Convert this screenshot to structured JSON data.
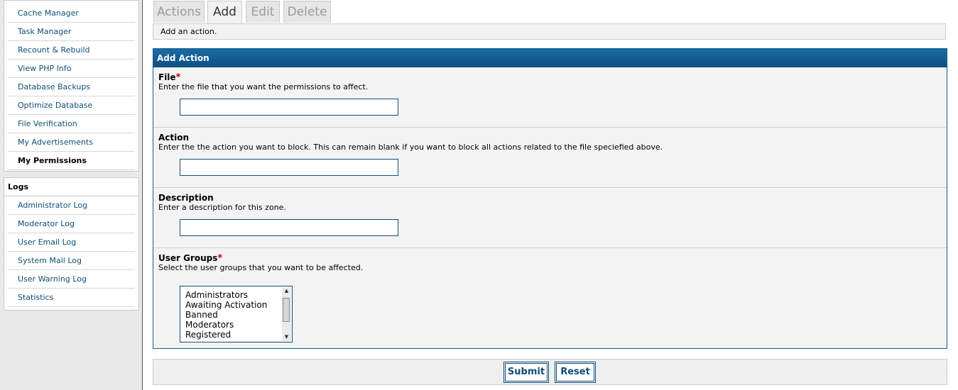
{
  "sidebar": {
    "top_items": [
      {
        "label": "Cache Manager"
      },
      {
        "label": "Task Manager"
      },
      {
        "label": "Recount & Rebuild"
      },
      {
        "label": "View PHP Info"
      },
      {
        "label": "Database Backups"
      },
      {
        "label": "Optimize Database"
      },
      {
        "label": "File Verification"
      },
      {
        "label": "My Advertisements"
      },
      {
        "label": "My Permissions"
      }
    ],
    "logs_title": "Logs",
    "log_items": [
      {
        "label": "Administrator Log"
      },
      {
        "label": "Moderator Log"
      },
      {
        "label": "User Email Log"
      },
      {
        "label": "System Mail Log"
      },
      {
        "label": "User Warning Log"
      },
      {
        "label": "Statistics"
      }
    ]
  },
  "tabs": [
    {
      "label": "Actions"
    },
    {
      "label": "Add"
    },
    {
      "label": "Edit"
    },
    {
      "label": "Delete"
    }
  ],
  "active_tab": "Add",
  "tab_description": "Add an action.",
  "form": {
    "title": "Add Action",
    "required_marker": "*",
    "file": {
      "label": "File",
      "description": "Enter the file that you want the permissions to affect.",
      "value": ""
    },
    "action": {
      "label": "Action",
      "description": "Enter the the action you want to block. This can remain blank if you want to block all actions related to the file speciefied above.",
      "value": ""
    },
    "description": {
      "label": "Description",
      "description": "Enter a description for this zone.",
      "value": ""
    },
    "user_groups": {
      "label": "User Groups",
      "description": "Select the user groups that you want to be affected.",
      "options": [
        "Administrators",
        "Awaiting Activation",
        "Banned",
        "Moderators",
        "Registered"
      ]
    }
  },
  "buttons": {
    "submit": "Submit",
    "reset": "Reset"
  },
  "colors": {
    "header_blue": "#0c4f82",
    "link_blue": "#0f4e78",
    "required_red": "#cc0000"
  }
}
